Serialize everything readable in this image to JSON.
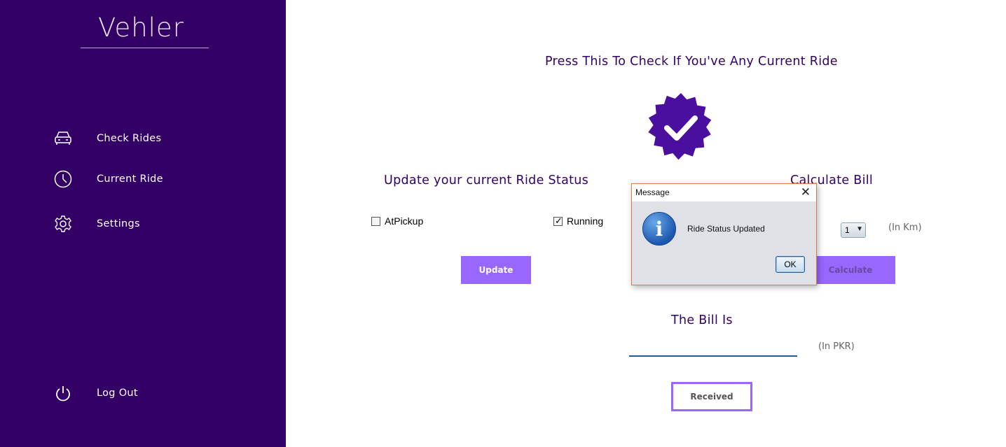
{
  "sidebar": {
    "brand": "Vehler",
    "items": [
      {
        "label": "Check Rides",
        "icon": "car-icon"
      },
      {
        "label": "Current Ride",
        "icon": "clock-icon"
      },
      {
        "label": "Settings",
        "icon": "gear-icon"
      }
    ],
    "logout": {
      "label": "Log Out",
      "icon": "power-icon"
    }
  },
  "main": {
    "check_prompt": "Press This To Check If You've Any Current Ride",
    "update_section": {
      "heading": "Update your current Ride Status",
      "options": [
        {
          "label": "AtPickup",
          "checked": false
        },
        {
          "label": "Running",
          "checked": true
        }
      ],
      "button": "Update"
    },
    "bill_section": {
      "heading": "Calculate Bill",
      "distance_value": "1",
      "distance_unit": "(In Km)",
      "button": "Calculate"
    },
    "bill_result": {
      "heading": "The Bill Is",
      "value": "",
      "unit": "(In PKR)",
      "button": "Received"
    }
  },
  "dialog": {
    "title": "Message",
    "message": "Ride Status Updated",
    "ok_label": "OK",
    "close_glyph": "✕"
  },
  "colors": {
    "sidebar_bg": "#330066",
    "accent": "#9966ff",
    "heading": "#330066"
  }
}
